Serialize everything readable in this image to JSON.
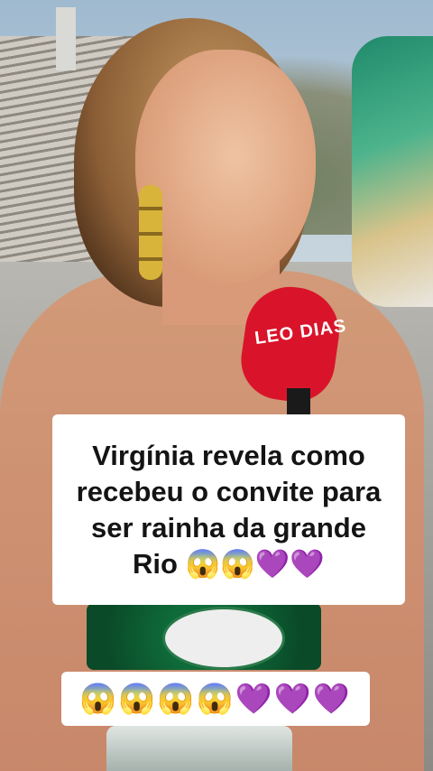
{
  "video": {
    "microphone_logo": "LEO DIAS"
  },
  "caption": {
    "title": "Virgínia revela como recebeu o convite para ser rainha da grande Rio 😱😱💜💜",
    "emoji_line": "😱😱😱😱💜💜💜"
  },
  "colors": {
    "mic_red": "#d9142a",
    "caption_bg": "#ffffff",
    "caption_text": "#141414"
  }
}
